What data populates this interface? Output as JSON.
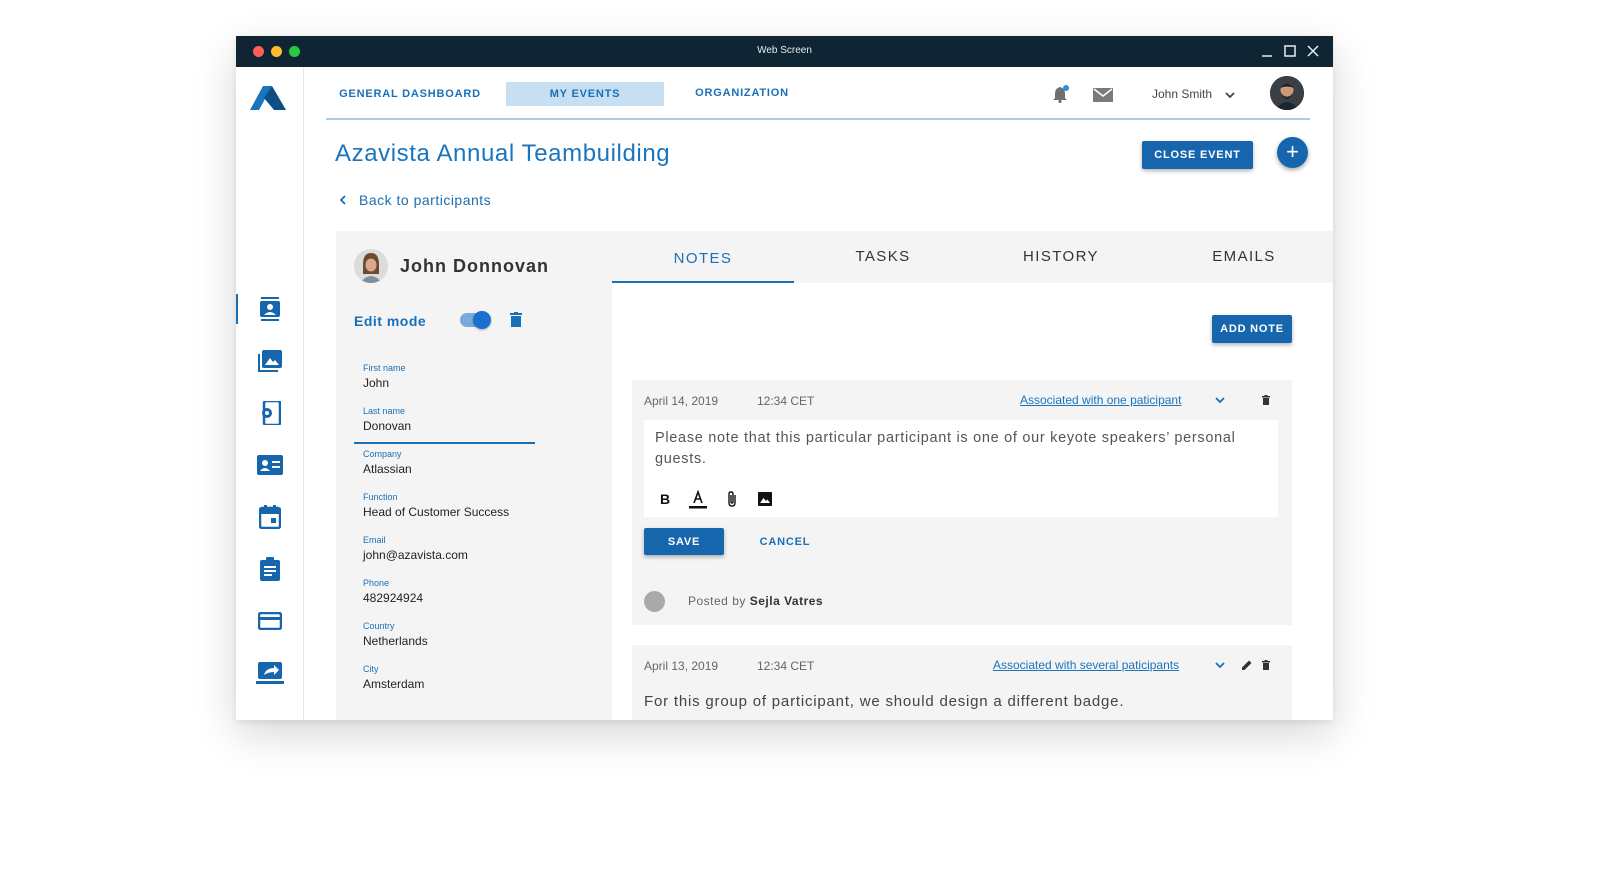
{
  "window": {
    "title": "Web Screen"
  },
  "colors": {
    "brand": "#1b6fb6",
    "titlebar": "#0f2533",
    "dot_red": "#ff5f57",
    "dot_yellow": "#febc2e",
    "dot_green": "#28c840"
  },
  "nav": {
    "items": [
      {
        "label": "GENERAL DASHBOARD"
      },
      {
        "label": "MY EVENTS"
      },
      {
        "label": "ORGANIZATION"
      }
    ],
    "user_name": "John Smith"
  },
  "sidebar": {
    "icons": [
      "contacts-icon",
      "photo-library-icon",
      "settings-phone-icon",
      "contact-card-icon",
      "calendar-icon",
      "assignment-icon",
      "credit-card-icon",
      "share-screen-icon"
    ]
  },
  "event": {
    "title": "Azavista Annual Teambuilding",
    "close_label": "CLOSE EVENT",
    "add_label": "+",
    "back_label": "Back to participants"
  },
  "participant": {
    "name": "John Donnovan",
    "edit_mode_label": "Edit mode",
    "edit_mode_on": true,
    "fields": [
      {
        "label": "First name",
        "value": "John"
      },
      {
        "label": "Last name",
        "value": "Donovan"
      },
      {
        "label": "Company",
        "value": "Atlassian"
      },
      {
        "label": "Function",
        "value": "Head of Customer Success"
      },
      {
        "label": "Email",
        "value": "john@azavista.com"
      },
      {
        "label": "Phone",
        "value": "482924924"
      },
      {
        "label": "Country",
        "value": "Netherlands"
      },
      {
        "label": "City",
        "value": "Amsterdam"
      }
    ]
  },
  "tabs": [
    {
      "label": "NOTES"
    },
    {
      "label": "TASKS"
    },
    {
      "label": "HISTORY"
    },
    {
      "label": "EMAILS"
    }
  ],
  "notes_panel": {
    "add_label": "ADD NOTE",
    "notes": [
      {
        "date": "April 14, 2019",
        "time": "12:34 CET",
        "association": "Associated with one paticipant",
        "text": "Please note that this particular participant is one of our keyote speakers’ personal guests.",
        "save_label": "SAVE",
        "cancel_label": "CANCEL",
        "posted_prefix": "Posted by",
        "posted_by": "Sejla Vatres"
      },
      {
        "date": "April 13, 2019",
        "time": "12:34 CET",
        "association": "Associated with several paticipants",
        "text": "For this group of participant, we should design a different badge."
      }
    ]
  }
}
